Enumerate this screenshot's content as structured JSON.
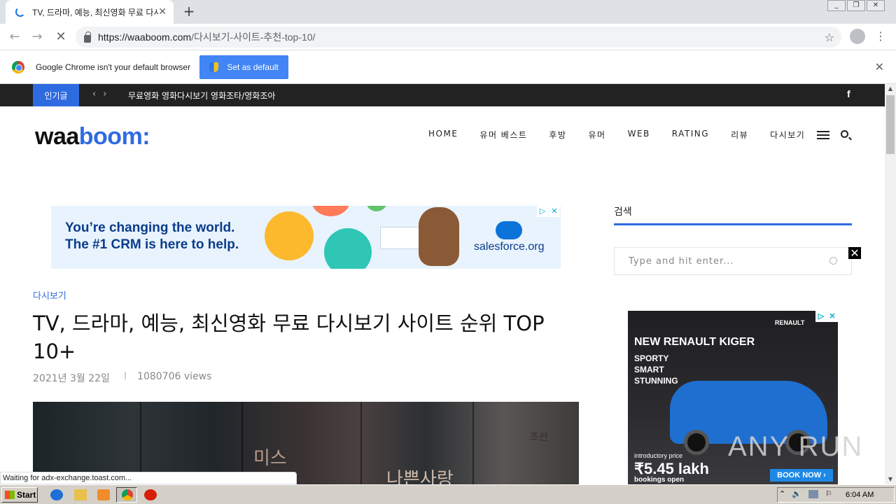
{
  "browser": {
    "tab_title": "TV, 드라마, 예능, 최신영화 무료 다시보기 사이트 순위 TOP 10+",
    "tab_close": "✕",
    "new_tab": "+",
    "url_host": "https://waaboom.com",
    "url_path": "/다시보기-사이트-추천-top-10/",
    "infobar_text": "Google Chrome isn't your default browser",
    "infobar_button": "Set as default",
    "status_text": "Waiting for adx-exchange.toast.com..."
  },
  "site": {
    "topbar_badge": "인기글",
    "ticker_text": "무료영화 영화다시보기 영화조타/영화조아",
    "social_icon": "f",
    "logo_part1": "waa",
    "logo_part2": "boom:",
    "nav": [
      "HOME",
      "유머 베스트",
      "후방",
      "유머",
      "WEB",
      "RATING",
      "리뷰",
      "다시보기"
    ]
  },
  "ad_banner": {
    "headline_line1": "You’re changing the world.",
    "headline_line2": "The #1 CRM is here to help.",
    "brand": "salesforce.org"
  },
  "post": {
    "category": "다시보기",
    "title": "TV, 드라마, 예능, 최신영화 무료 다시보기 사이트 순위 TOP 10+",
    "date": "2021년 3월 22일",
    "separator": "I",
    "views": "1080706 views",
    "hero_text1": "미스",
    "hero_text2": "나쁜사랑",
    "hero_text3": "조선"
  },
  "sidebar": {
    "widget_title": "검색",
    "search_placeholder": "Type and hit enter...",
    "close_label": "✕"
  },
  "ad_side": {
    "brand": "RENAULT",
    "headline": "NEW RENAULT KIGER",
    "line1": "SPORTY",
    "line2": "SMART",
    "line3": "STUNNING",
    "intro": "introductory price",
    "price": "₹5.45 lakh",
    "bookings": "bookings open",
    "cta": "BOOK NOW ›"
  },
  "watermark": "ANY RUN",
  "taskbar": {
    "start_label": "Start",
    "clock": "6:04 AM"
  }
}
